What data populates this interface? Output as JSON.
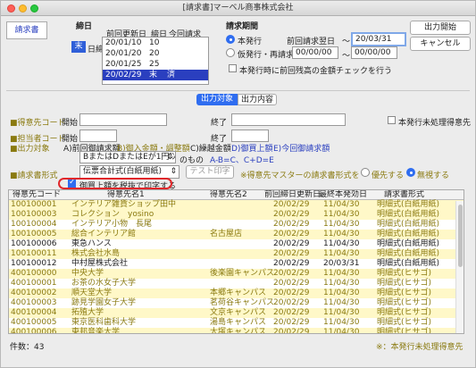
{
  "window": {
    "title": "[請求書]マーベル商事株式会社"
  },
  "tab": {
    "label": "請求書"
  },
  "cutoff": {
    "label": "締日",
    "day_value": "末",
    "day_suffix": "日締",
    "col_prev": "前回更新日",
    "col_close": "締日",
    "col_this": "今回請求",
    "rows": [
      {
        "date": "20/01/10",
        "close": "10",
        "this": ""
      },
      {
        "date": "20/01/20",
        "close": "20",
        "this": ""
      },
      {
        "date": "20/01/25",
        "close": "25",
        "this": ""
      },
      {
        "date": "20/02/29",
        "close": "末",
        "this": "済"
      }
    ]
  },
  "period": {
    "label": "請求期間",
    "opt_issue": "本発行",
    "opt_reissue": "仮発行・再請求",
    "from_label": "前回請求翌日",
    "tilde": "〜",
    "to_value": "20/03/31",
    "re_from": "00/00/00",
    "re_to": "00/00/00",
    "check_label": "本発行時に前回残高の金額チェックを行う"
  },
  "buttons": {
    "start": "出力開始",
    "cancel": "キャンセル"
  },
  "tabs2": {
    "target": "出力対象",
    "content": "出力内容"
  },
  "filters": {
    "customer_code": "得意先コード",
    "staff_code": "担当者コード",
    "output_target": "出力対象",
    "invoice_form": "請求書形式",
    "start_label": "開始",
    "end_label": "終了",
    "unprocessed_label": "本発行未処理得意先"
  },
  "target_options": {
    "a": "A)前回御請求額",
    "b": "B)御入金額・調整額",
    "c": "C)繰越金額",
    "d": "D)御買上額",
    "e": "E)今回御請求額"
  },
  "condition": {
    "select": "BまたはDまたはEが1円以上",
    "suffix": "のもの",
    "hint": "A-B=C、C+D=E"
  },
  "form": {
    "select": "伝票合計式(白紙用紙)",
    "test_print": "テスト印字",
    "note": "※得意先マスターの請求書形式を",
    "prefer": "優先する",
    "ignore": "無視する",
    "tax_check": "御買上額を税抜で印字する"
  },
  "table": {
    "headers": [
      "得意先コード",
      "得意先名1",
      "得意先名2",
      "前回締日更新日",
      "最終本発効日",
      "請求書形式"
    ],
    "rows": [
      {
        "code": "100100001",
        "name1": "インテリア雑貨ショップ田中",
        "name2": "",
        "prev": "20/02/29",
        "last": "11/04/30",
        "form": "明細式(白紙用紙)",
        "style": "y"
      },
      {
        "code": "100100003",
        "name1": "コレクション　yosino",
        "name2": "",
        "prev": "20/02/29",
        "last": "11/04/30",
        "form": "明細式(白紙用紙)",
        "style": "y"
      },
      {
        "code": "100100004",
        "name1": "インテリア小物　長尾",
        "name2": "",
        "prev": "20/02/29",
        "last": "11/04/30",
        "form": "明細式(白紙用紙)",
        "style": "w"
      },
      {
        "code": "100100005",
        "name1": "総合インテリア館",
        "name2": "名古屋店",
        "prev": "20/02/29",
        "last": "11/04/30",
        "form": "明細式(白紙用紙)",
        "style": "y"
      },
      {
        "code": "100100006",
        "name1": "東急ハンス",
        "name2": "",
        "prev": "20/02/29",
        "last": "11/04/30",
        "form": "明細式(白紙用紙)",
        "style": "w"
      },
      {
        "code": "100100011",
        "name1": "株式会社水島",
        "name2": "",
        "prev": "20/02/29",
        "last": "11/04/30",
        "form": "明細式(白紙用紙)",
        "style": "y"
      },
      {
        "code": "100100012",
        "name1": "中村屋株式会社",
        "name2": "",
        "prev": "20/02/29",
        "last": "20/03/31",
        "form": "明細式(白紙用紙)",
        "style": "w"
      },
      {
        "code": "400100000",
        "name1": "中央大学",
        "name2": "後楽園キャンパス",
        "prev": "20/02/29",
        "last": "11/04/30",
        "form": "明細式(ヒサゴ)",
        "style": "y"
      },
      {
        "code": "400100001",
        "name1": "お茶の水女子大学",
        "name2": "",
        "prev": "20/02/29",
        "last": "11/04/30",
        "form": "明細式(ヒサゴ)",
        "style": "w"
      },
      {
        "code": "400100002",
        "name1": "順天堂大学",
        "name2": "本郷キャンパス",
        "prev": "20/02/29",
        "last": "11/04/30",
        "form": "明細式(ヒサゴ)",
        "style": "y"
      },
      {
        "code": "400100003",
        "name1": "跡見学園女子大学",
        "name2": "茗荷谷キャンパス",
        "prev": "20/02/29",
        "last": "11/04/30",
        "form": "明細式(ヒサゴ)",
        "style": "w"
      },
      {
        "code": "400100004",
        "name1": "拓殖大学",
        "name2": "文京キャンパス",
        "prev": "20/02/29",
        "last": "11/04/30",
        "form": "明細式(ヒサゴ)",
        "style": "y"
      },
      {
        "code": "400100005",
        "name1": "東京医科歯科大学",
        "name2": "湯島キャンパス",
        "prev": "20/02/29",
        "last": "11/04/30",
        "form": "明細式(ヒサゴ)",
        "style": "w"
      },
      {
        "code": "400100006",
        "name1": "東邦音楽大学",
        "name2": "大塚キャンパス",
        "prev": "20/02/29",
        "last": "11/04/30",
        "form": "明細式(ヒサゴ)",
        "style": "y"
      }
    ]
  },
  "footer": {
    "count_label": "件数：",
    "count": "43",
    "note": "※：本発行未処理得意先"
  }
}
